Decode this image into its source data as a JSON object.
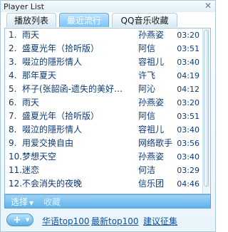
{
  "window": {
    "title": "Player List",
    "close_glyph": "✕"
  },
  "tabs": [
    {
      "label": "播放列表"
    },
    {
      "label": "最近流行"
    },
    {
      "label": "QQ音乐收藏"
    }
  ],
  "active_tab": "最近流行",
  "playlist": [
    {
      "num": "1.",
      "song": "雨天",
      "artist": "孙燕姿",
      "time": "03:20"
    },
    {
      "num": "2.",
      "song": "盛夏光年（拾听版）",
      "artist": "阿信",
      "time": "03:51"
    },
    {
      "num": "3.",
      "song": "啜泣的隱形情人",
      "artist": "容祖儿",
      "time": "03:40"
    },
    {
      "num": "4.",
      "song": "那年夏天",
      "artist": "许飞",
      "time": "04:19"
    },
    {
      "num": "5.",
      "song": "杯子(张韶函-遗失的美好…",
      "artist": "阿沁",
      "time": "04:12"
    },
    {
      "num": "6.",
      "song": "雨天",
      "artist": "孙燕姿",
      "time": "03:20"
    },
    {
      "num": "7.",
      "song": "盛夏光年（拾听版）",
      "artist": "阿信",
      "time": "03:51"
    },
    {
      "num": "8.",
      "song": "啜泣的隱形情人",
      "artist": "容祖儿",
      "time": "03:40"
    },
    {
      "num": "9.",
      "song": "用爱交换自由",
      "artist": "网络歌手",
      "time": "03:56"
    },
    {
      "num": "10.",
      "song": "梦想天空",
      "artist": "孙燕姿",
      "time": "03:40"
    },
    {
      "num": "11.",
      "song": "迷恋",
      "artist": "何洁",
      "time": "03:29"
    },
    {
      "num": "12.",
      "song": "不会消失的夜晚",
      "artist": "信乐团",
      "time": "04:46"
    }
  ],
  "actions": {
    "select_label": "选择",
    "collect_label": "收藏"
  },
  "footer": {
    "add_icon": "+",
    "links": [
      {
        "label": "华语top100"
      },
      {
        "label": "最新top100"
      },
      {
        "label": "建议征集"
      }
    ]
  }
}
